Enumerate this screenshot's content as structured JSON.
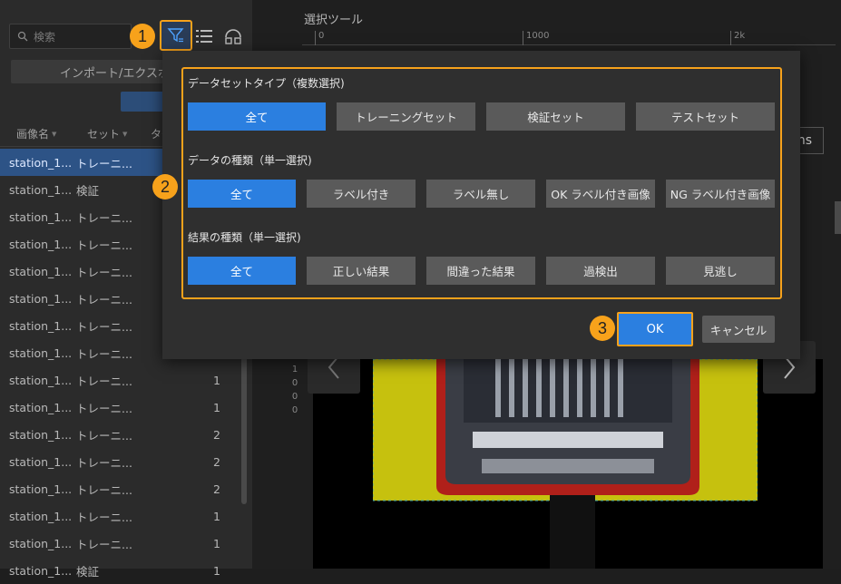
{
  "sidebar": {
    "search_placeholder": "検索",
    "import_label": "インポート/エクスポ",
    "columns": [
      {
        "label": "画像名"
      },
      {
        "label": "セット"
      },
      {
        "label": "タグ"
      }
    ],
    "rows": [
      {
        "name": "station_1...",
        "set": "トレーニ...",
        "count": "",
        "selected": true
      },
      {
        "name": "station_1...",
        "set": "検証",
        "count": ""
      },
      {
        "name": "station_1...",
        "set": "トレーニ...",
        "count": ""
      },
      {
        "name": "station_1...",
        "set": "トレーニ...",
        "count": ""
      },
      {
        "name": "station_1...",
        "set": "トレーニ...",
        "count": ""
      },
      {
        "name": "station_1...",
        "set": "トレーニ...",
        "count": ""
      },
      {
        "name": "station_1...",
        "set": "トレーニ...",
        "count": ""
      },
      {
        "name": "station_1...",
        "set": "トレーニ...",
        "count": ""
      },
      {
        "name": "station_1...",
        "set": "トレーニ...",
        "count": "1"
      },
      {
        "name": "station_1...",
        "set": "トレーニ...",
        "count": "1"
      },
      {
        "name": "station_1...",
        "set": "トレーニ...",
        "count": "2"
      },
      {
        "name": "station_1...",
        "set": "トレーニ...",
        "count": "2"
      },
      {
        "name": "station_1...",
        "set": "トレーニ...",
        "count": "2"
      },
      {
        "name": "station_1...",
        "set": "トレーニ...",
        "count": "1"
      },
      {
        "name": "station_1...",
        "set": "トレーニ...",
        "count": "1"
      },
      {
        "name": "station_1...",
        "set": "検証",
        "count": "1"
      }
    ]
  },
  "workspace": {
    "tool_title": "選択ツール",
    "ruler_ticks": [
      "0",
      "1000",
      "2k"
    ],
    "vruler": [
      "1",
      "0",
      "0",
      "0"
    ],
    "ms_text": "ns"
  },
  "dialog": {
    "dataset_type": {
      "label": "データセットタイプ（複数選択)",
      "options": [
        "全て",
        "トレーニングセット",
        "検証セット",
        "テストセット"
      ]
    },
    "data_kind": {
      "label": "データの種類（単一選択)",
      "options": [
        "全て",
        "ラベル付き",
        "ラベル無し",
        "OK ラベル付き画像",
        "NG ラベル付き画像"
      ]
    },
    "result_kind": {
      "label": "結果の種類（単一選択)",
      "options": [
        "全て",
        "正しい結果",
        "間違った結果",
        "過検出",
        "見逃し"
      ]
    },
    "ok_label": "OK",
    "cancel_label": "キャンセル"
  },
  "badges": [
    "1",
    "2",
    "3"
  ],
  "colors": {
    "accent": "#2b7fe0",
    "highlight": "#f7a21b"
  }
}
